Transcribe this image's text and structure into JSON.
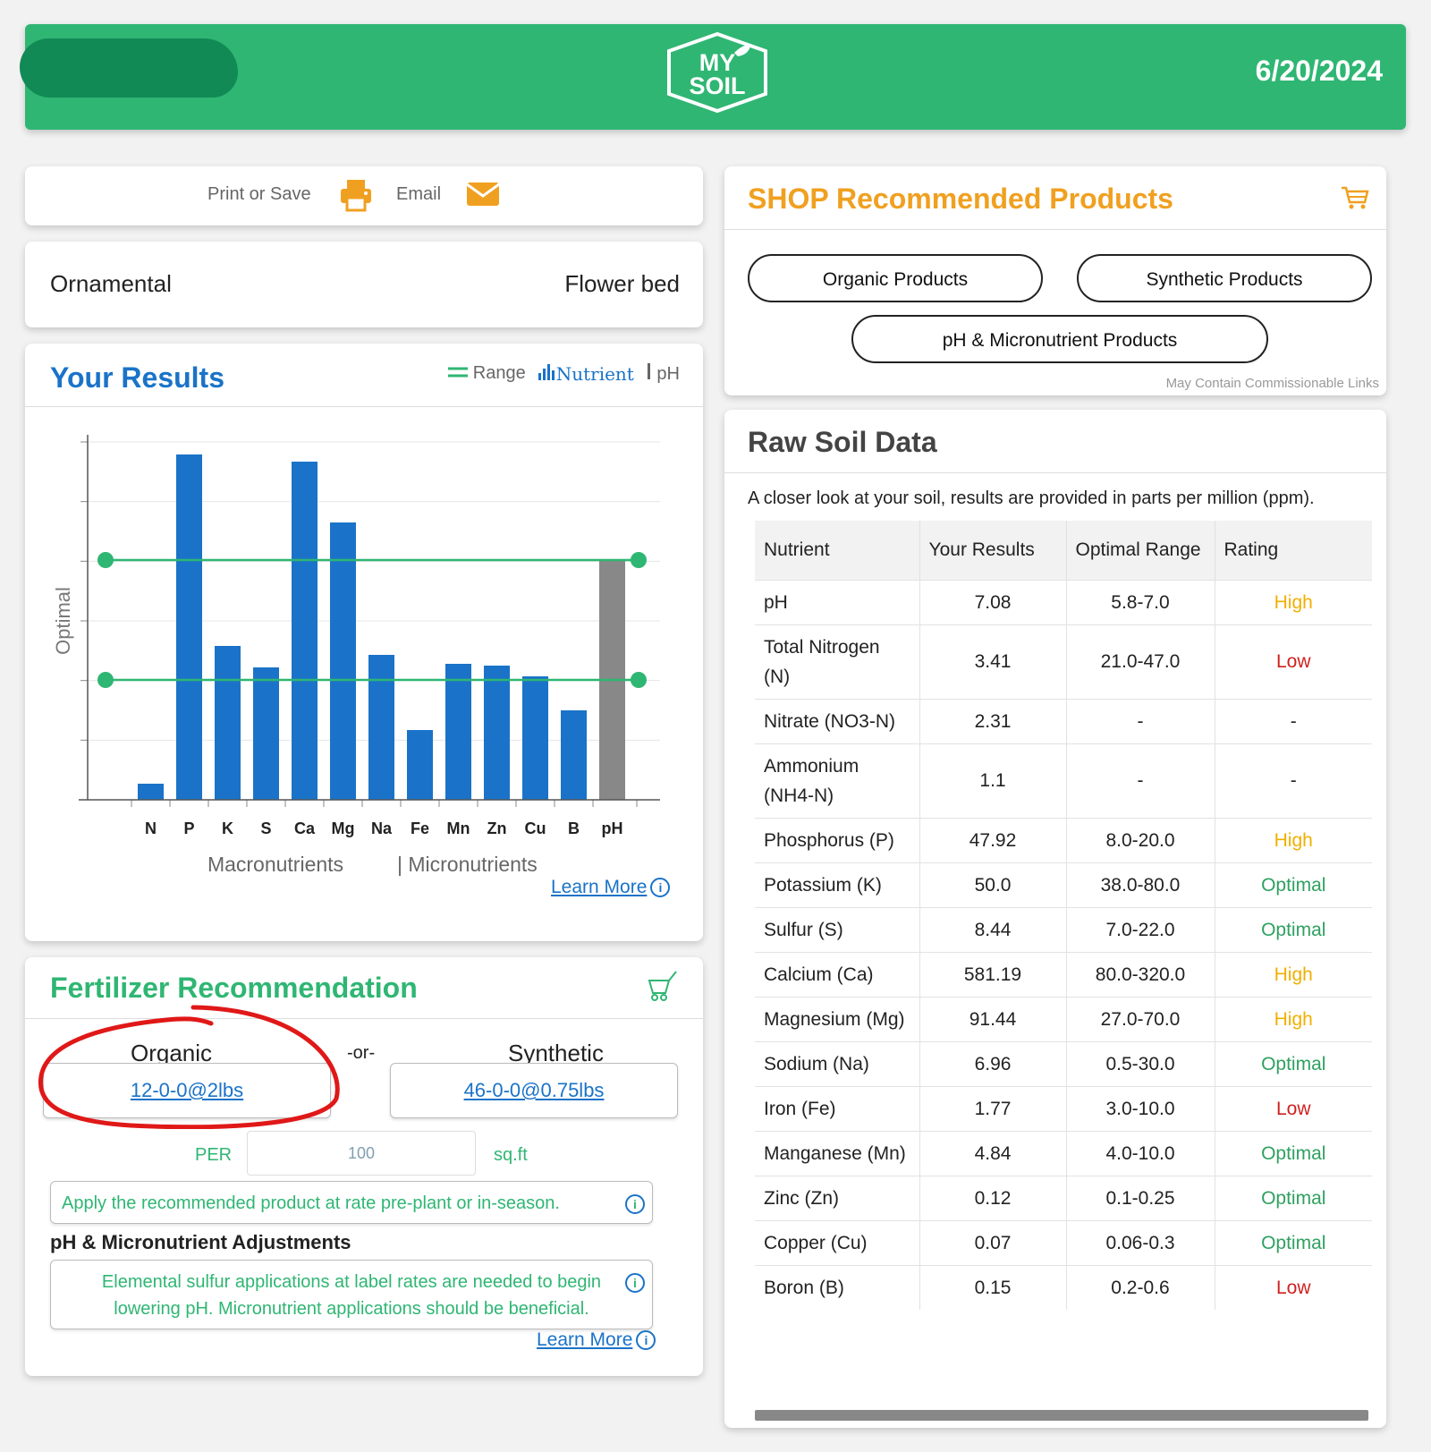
{
  "header": {
    "logo_line1": "MY",
    "logo_line2": "SOIL",
    "date": "6/20/2024"
  },
  "toolbar": {
    "print_label": "Print or Save",
    "email_label": "Email",
    "print_icon": "printer-icon",
    "email_icon": "envelope-icon"
  },
  "category": {
    "left": "Ornamental",
    "right": "Flower bed"
  },
  "results": {
    "title": "Your Results",
    "legend": {
      "range": "Range",
      "nutrient": "Nutrient",
      "ph": "pH"
    },
    "learn_more": "Learn More"
  },
  "chart_data": {
    "type": "bar",
    "ylabel": "Optimal",
    "categories": [
      "N",
      "P",
      "K",
      "S",
      "Ca",
      "Mg",
      "Na",
      "Fe",
      "Mn",
      "Zn",
      "Cu",
      "B",
      "pH"
    ],
    "values": [
      4.5,
      96.5,
      43,
      37,
      94.5,
      77.5,
      40.5,
      19.5,
      38,
      37.5,
      34.5,
      25,
      67
    ],
    "ylim": [
      0,
      100
    ],
    "optimal_range": [
      33.5,
      67
    ],
    "group_labels": [
      "Macronutrients",
      "| Micronutrients"
    ],
    "colors": {
      "nutrient": "#1a73c8",
      "ph": "#888888",
      "range": "#2fb673"
    }
  },
  "fertilizer": {
    "title": "Fertilizer Recommendation",
    "organic_label": "Organic",
    "or_label": "-or-",
    "synthetic_label": "Synthetic",
    "organic_product": "12-0-0@2lbs",
    "synthetic_product": "46-0-0@0.75lbs",
    "per_label": "PER",
    "area_value": "100",
    "unit_label": "sq.ft",
    "apply_note": "Apply the recommended product at rate pre-plant or in-season.",
    "adjust_title": "pH & Micronutrient Adjustments",
    "adjust_note": "Elemental sulfur applications at label rates are needed to begin lowering pH. Micronutrient applications should be beneficial.",
    "learn_more": "Learn More"
  },
  "shop": {
    "title": "SHOP Recommended Products",
    "buttons": [
      "Organic Products",
      "Synthetic Products",
      "pH & Micronutrient Products"
    ],
    "note": "May Contain Commissionable Links"
  },
  "raw": {
    "title": "Raw Soil Data",
    "description": "A closer look at your soil, results are provided in parts per million (ppm).",
    "columns": [
      "Nutrient",
      "Your Results",
      "Optimal Range",
      "Rating"
    ],
    "rows": [
      {
        "nutrient": "pH",
        "result": "7.08",
        "range": "5.8-7.0",
        "rating": "High",
        "level": "high"
      },
      {
        "nutrient": "Total Nitrogen (N)",
        "result": "3.41",
        "range": "21.0-47.0",
        "rating": "Low",
        "level": "low"
      },
      {
        "nutrient": "Nitrate (NO3-N)",
        "result": "2.31",
        "range": "-",
        "rating": "-",
        "level": "none"
      },
      {
        "nutrient": "Ammonium (NH4-N)",
        "result": "1.1",
        "range": "-",
        "rating": "-",
        "level": "none"
      },
      {
        "nutrient": "Phosphorus (P)",
        "result": "47.92",
        "range": "8.0-20.0",
        "rating": "High",
        "level": "high"
      },
      {
        "nutrient": "Potassium (K)",
        "result": "50.0",
        "range": "38.0-80.0",
        "rating": "Optimal",
        "level": "optimal"
      },
      {
        "nutrient": "Sulfur (S)",
        "result": "8.44",
        "range": "7.0-22.0",
        "rating": "Optimal",
        "level": "optimal"
      },
      {
        "nutrient": "Calcium (Ca)",
        "result": "581.19",
        "range": "80.0-320.0",
        "rating": "High",
        "level": "high"
      },
      {
        "nutrient": "Magnesium (Mg)",
        "result": "91.44",
        "range": "27.0-70.0",
        "rating": "High",
        "level": "high"
      },
      {
        "nutrient": "Sodium (Na)",
        "result": "6.96",
        "range": "0.5-30.0",
        "rating": "Optimal",
        "level": "optimal"
      },
      {
        "nutrient": "Iron (Fe)",
        "result": "1.77",
        "range": "3.0-10.0",
        "rating": "Low",
        "level": "low"
      },
      {
        "nutrient": "Manganese (Mn)",
        "result": "4.84",
        "range": "4.0-10.0",
        "rating": "Optimal",
        "level": "optimal"
      },
      {
        "nutrient": "Zinc (Zn)",
        "result": "0.12",
        "range": "0.1-0.25",
        "rating": "Optimal",
        "level": "optimal"
      },
      {
        "nutrient": "Copper (Cu)",
        "result": "0.07",
        "range": "0.06-0.3",
        "rating": "Optimal",
        "level": "optimal"
      },
      {
        "nutrient": "Boron (B)",
        "result": "0.15",
        "range": "0.2-0.6",
        "rating": "Low",
        "level": "low"
      }
    ]
  }
}
